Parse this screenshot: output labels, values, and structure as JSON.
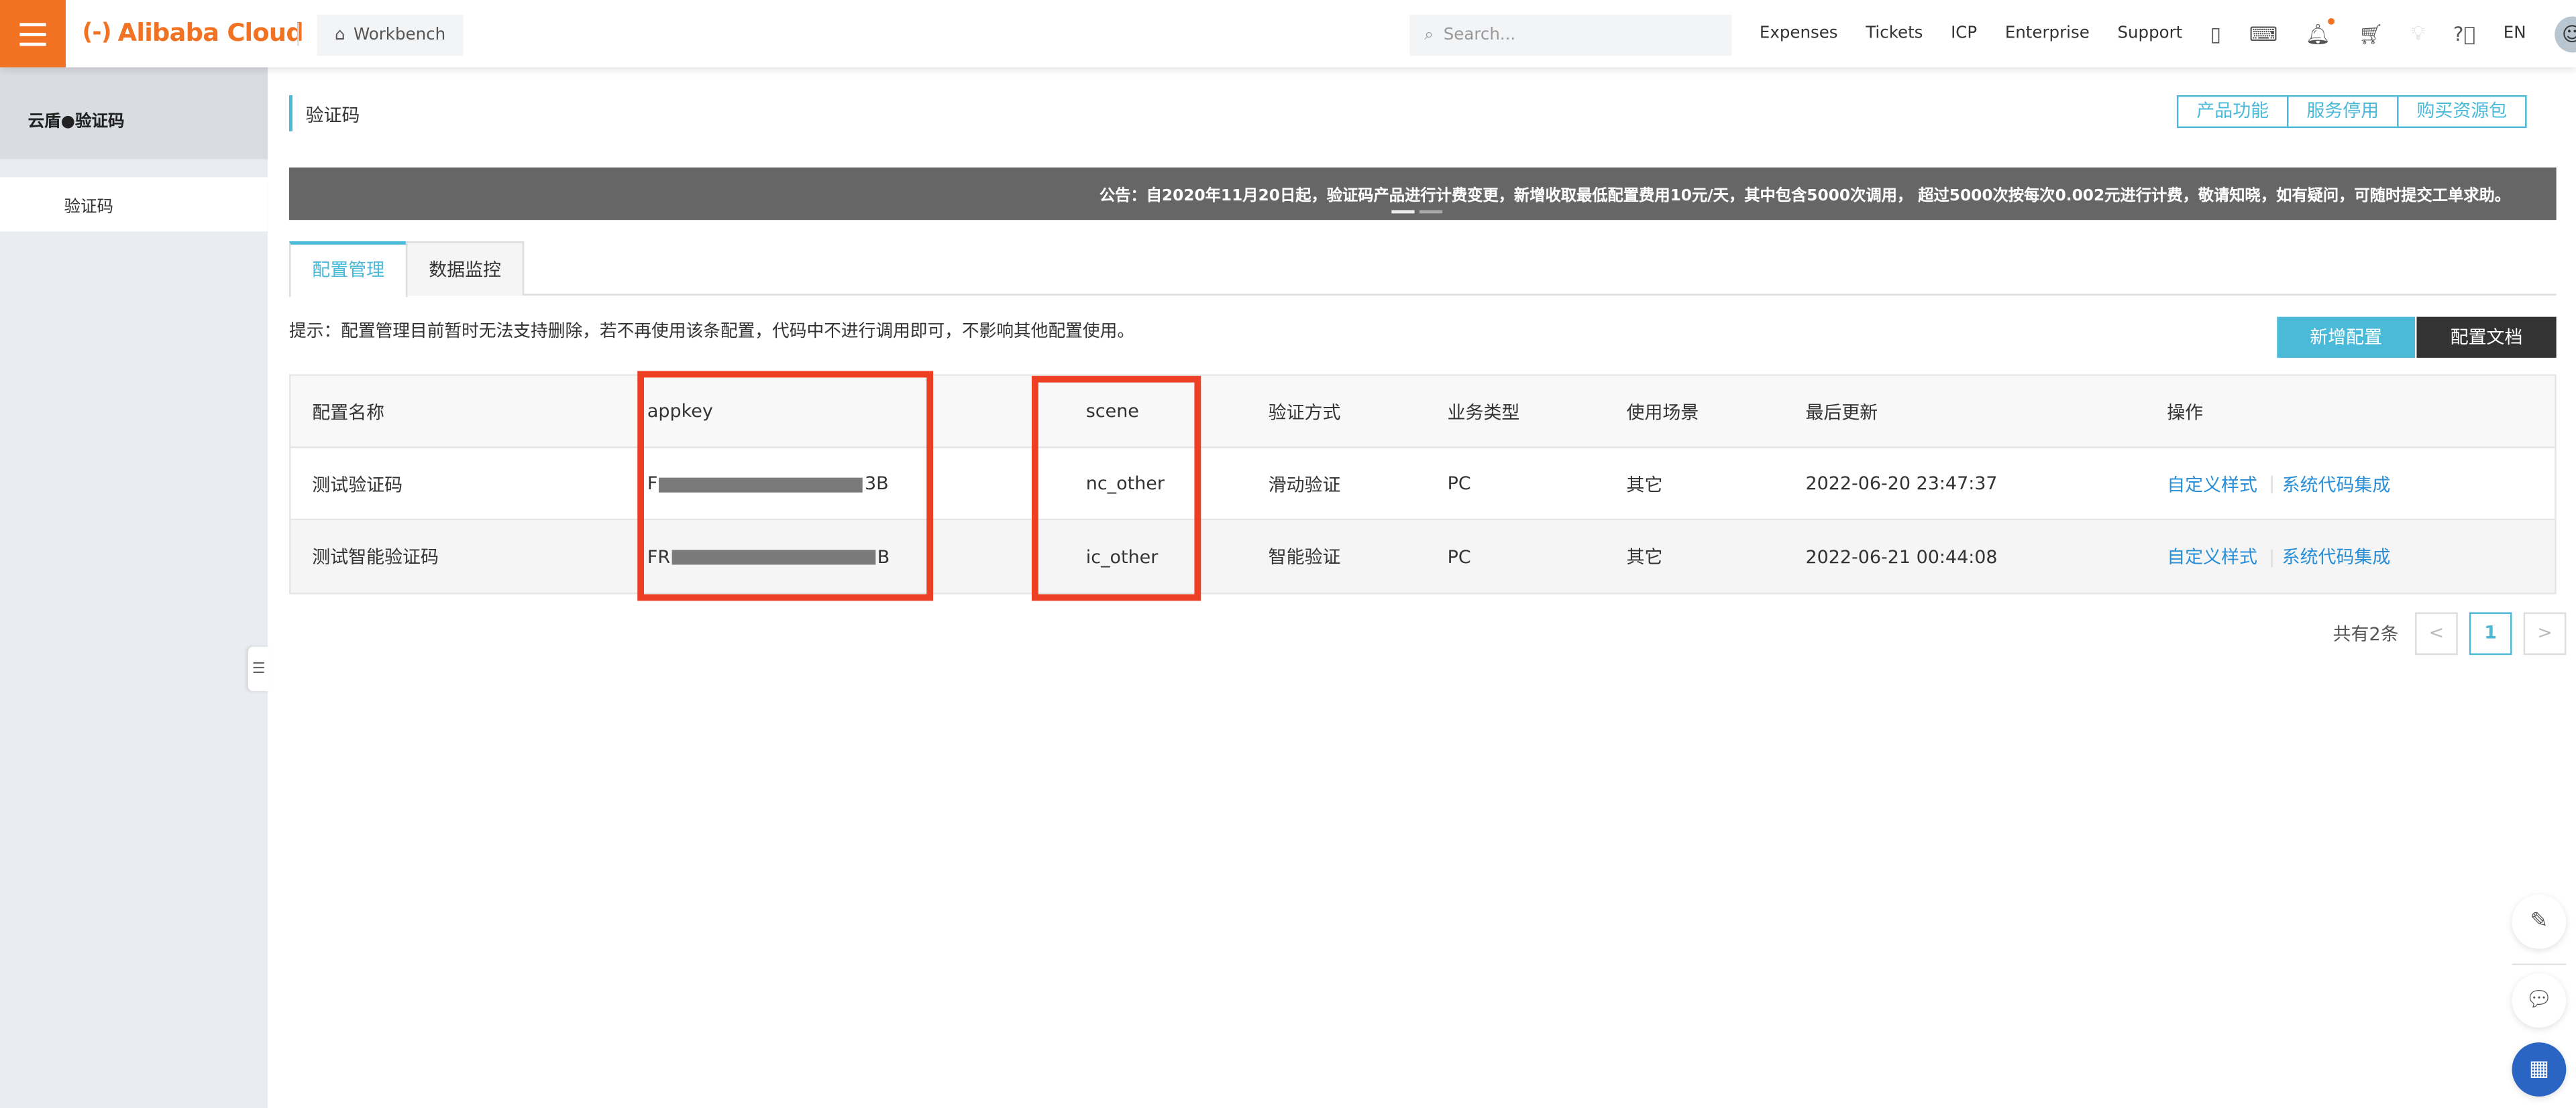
{
  "header": {
    "brand": "Alibaba Cloud",
    "workbench": "Workbench",
    "search_placeholder": "Search...",
    "nav": [
      "Expenses",
      "Tickets",
      "ICP",
      "Enterprise",
      "Support"
    ],
    "language": "EN",
    "icons": [
      "app-icon",
      "terminal-icon",
      "bell-icon",
      "cart-icon",
      "bulb-icon",
      "help-icon"
    ]
  },
  "sidebar": {
    "title": "云盾●验证码",
    "items": [
      {
        "label": "验证码"
      }
    ]
  },
  "page": {
    "title": "验证码",
    "actions": [
      "产品功能",
      "服务停用",
      "购买资源包"
    ],
    "announcement": "公告：自2020年11月20日起，验证码产品进行计费变更，新增收取最低配置费用10元/天，其中包含5000次调用， 超过5000次按每次0.002元进行计费，敬请知晓，如有疑问，可随时提交工单求助。",
    "tabs": [
      {
        "label": "配置管理",
        "active": true
      },
      {
        "label": "数据监控",
        "active": false
      }
    ],
    "hint": "提示：配置管理目前暂时无法支持删除，若不再使用该条配置，代码中不进行调用即可，不影响其他配置使用。",
    "add_button": "新增配置",
    "docs_button": "配置文档"
  },
  "table": {
    "columns": [
      "配置名称",
      "appkey",
      "scene",
      "验证方式",
      "业务类型",
      "使用场景",
      "最后更新",
      "操作"
    ],
    "rows": [
      {
        "name": "测试验证码",
        "appkey_prefix": "F",
        "appkey_suffix": "3B",
        "scene": "nc_other",
        "method": "滑动验证",
        "biz": "PC",
        "usage": "其它",
        "updated": "2022-06-20 23:47:37",
        "actions": [
          "自定义样式",
          "系统代码集成"
        ]
      },
      {
        "name": "测试智能验证码",
        "appkey_prefix": "FR",
        "appkey_suffix": "B",
        "scene": "ic_other",
        "method": "智能验证",
        "biz": "PC",
        "usage": "其它",
        "updated": "2022-06-21 00:44:08",
        "actions": [
          "自定义样式",
          "系统代码集成"
        ]
      }
    ]
  },
  "pagination": {
    "total": "共有2条",
    "current": "1",
    "prev": "<",
    "next": ">"
  },
  "colors": {
    "brand": "#f07222",
    "accent": "#4bb9d8",
    "highlight": "#ec3f23",
    "fab": "#2a65c4"
  }
}
